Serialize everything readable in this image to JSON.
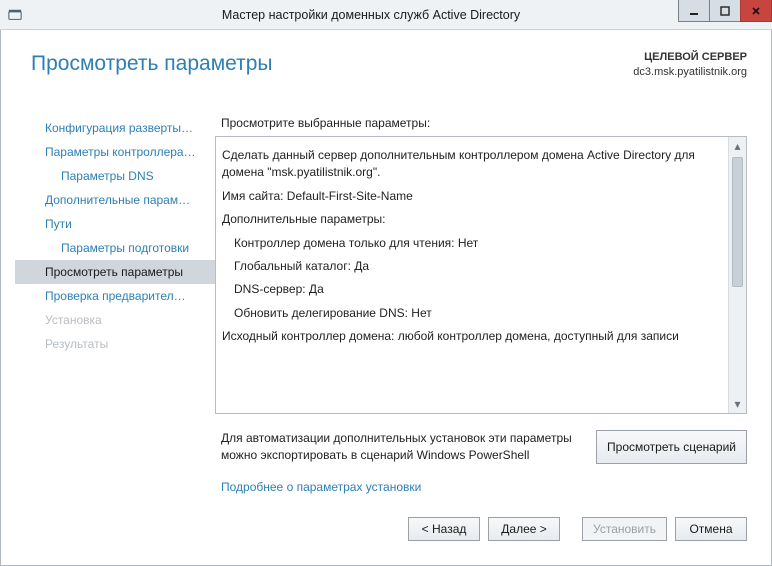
{
  "window": {
    "title": "Мастер настройки доменных служб Active Directory"
  },
  "header": {
    "page_title": "Просмотреть параметры",
    "target_label": "ЦЕЛЕВОЙ СЕРВЕР",
    "target_value": "dc3.msk.pyatilistnik.org"
  },
  "nav": {
    "items": [
      {
        "label": "Конфигурация разверты…",
        "sub": false,
        "state": "link"
      },
      {
        "label": "Параметры контроллера…",
        "sub": false,
        "state": "link"
      },
      {
        "label": "Параметры DNS",
        "sub": true,
        "state": "link"
      },
      {
        "label": "Дополнительные парам…",
        "sub": false,
        "state": "link"
      },
      {
        "label": "Пути",
        "sub": false,
        "state": "link"
      },
      {
        "label": "Параметры подготовки",
        "sub": true,
        "state": "link"
      },
      {
        "label": "Просмотреть параметры",
        "sub": false,
        "state": "current"
      },
      {
        "label": "Проверка предварител…",
        "sub": false,
        "state": "link"
      },
      {
        "label": "Установка",
        "sub": false,
        "state": "disabled"
      },
      {
        "label": "Результаты",
        "sub": false,
        "state": "disabled"
      }
    ]
  },
  "main": {
    "caption": "Просмотрите выбранные параметры:",
    "lines": {
      "l1": "Сделать данный сервер дополнительным контроллером домена Active Directory для домена \"msk.pyatilistnik.org\".",
      "l2": "Имя сайта: Default-First-Site-Name",
      "l3": "Дополнительные параметры:",
      "l4": "Контроллер домена только для чтения: Нет",
      "l5": "Глобальный каталог: Да",
      "l6": "DNS-сервер: Да",
      "l7": "Обновить делегирование DNS: Нет",
      "l8": "Исходный контроллер домена: любой контроллер домена, доступный для записи"
    },
    "automation_text": "Для автоматизации дополнительных установок эти параметры можно экспортировать в сценарий Windows PowerShell",
    "view_script": "Просмотреть сценарий",
    "more_link": "Подробнее о параметрах установки"
  },
  "footer": {
    "back": "< Назад",
    "next": "Далее >",
    "install": "Установить",
    "cancel": "Отмена"
  }
}
